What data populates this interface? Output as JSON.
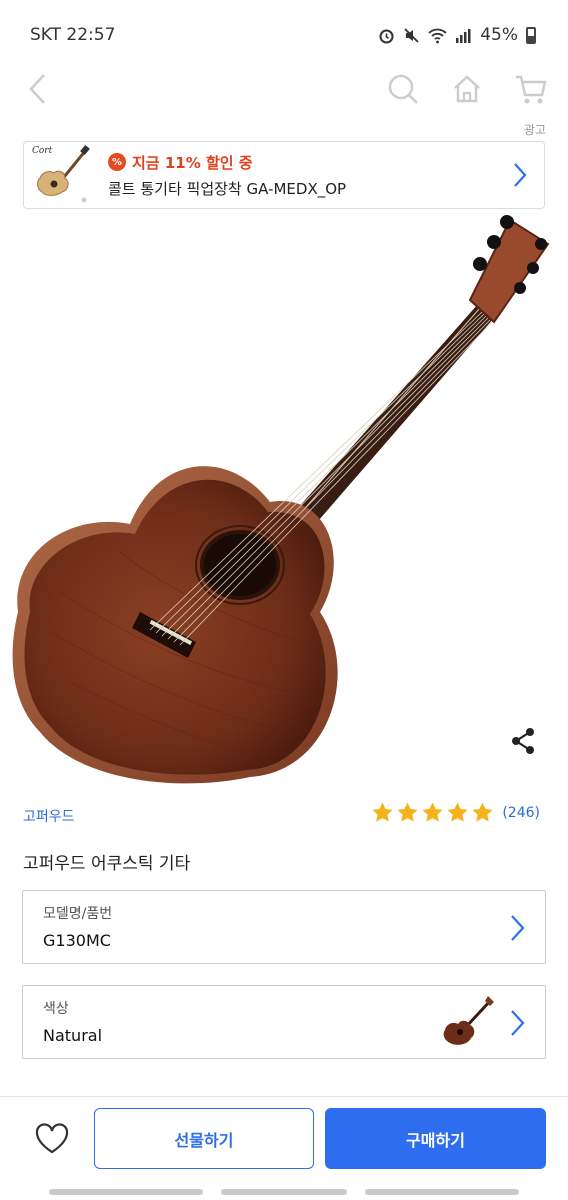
{
  "status_bar": {
    "carrier_time": "SKT 22:57",
    "battery": "45%"
  },
  "nav": {
    "back_icon": "chevron-left-icon",
    "search_icon": "search-icon",
    "home_icon": "home-icon",
    "cart_icon": "cart-icon"
  },
  "ad": {
    "tag": "광고",
    "brand": "Cort",
    "discount_badge": "%",
    "discount_text": "지금 11% 할인 중",
    "product_name": "콜트 통기타 픽업장착 GA-MEDX_OP"
  },
  "product": {
    "brand": "고퍼우드",
    "title": "고퍼우드 어쿠스틱 기타",
    "rating_stars": 5,
    "rating_count": "(246)"
  },
  "options": {
    "model": {
      "label": "모델명/품번",
      "value": "G130MC"
    },
    "color": {
      "label": "색상",
      "value": "Natural"
    }
  },
  "actions": {
    "gift": "선물하기",
    "buy": "구매하기"
  },
  "colors": {
    "accent": "#2f6df0",
    "discount": "#e0401c",
    "star": "#f6b21b"
  }
}
